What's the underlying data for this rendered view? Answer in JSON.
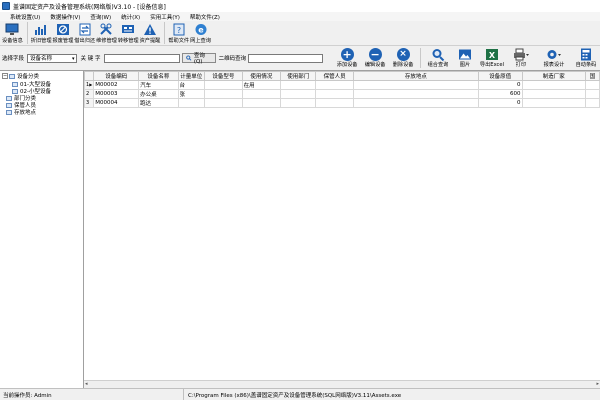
{
  "window": {
    "title": "盖谱固定资产及设备管理系统(网络版)V3.10 - [设备信息]"
  },
  "menu": [
    "系统设置(U)",
    "数据操作(V)",
    "查询(W)",
    "统计(X)",
    "实用工具(Y)",
    "帮助文件(Z)"
  ],
  "toolbar1": [
    {
      "label": "设备信息",
      "icon": "monitor-icon"
    },
    {
      "label": "折旧管理",
      "icon": "bar-chart-icon"
    },
    {
      "label": "报废管理",
      "icon": "scrap-icon"
    },
    {
      "label": "借出归还",
      "icon": "exchange-icon"
    },
    {
      "label": "维修管理",
      "icon": "tools-icon"
    },
    {
      "label": "转移管理",
      "icon": "transfer-icon"
    },
    {
      "label": "资产提醒",
      "icon": "warning-icon"
    },
    {
      "label": "帮助文件",
      "icon": "help-book-icon"
    },
    {
      "label": "网上查询",
      "icon": "browser-icon"
    }
  ],
  "search": {
    "field_label": "选择字段",
    "field_value": "设备名称",
    "keyword_label": "关 键 字",
    "keyword_value": "",
    "query_button": "查询(Q)",
    "qr_label": "二维码查询",
    "qr_value": ""
  },
  "toolbar2": [
    {
      "label": "添加设备",
      "icon": "add-icon"
    },
    {
      "label": "编辑设备",
      "icon": "edit-icon"
    },
    {
      "label": "删除设备",
      "icon": "delete-icon"
    },
    {
      "label": "组合查询",
      "icon": "search-icon"
    },
    {
      "label": "图片",
      "icon": "picture-icon"
    },
    {
      "label": "导出Excel",
      "icon": "excel-icon"
    },
    {
      "label": "打印",
      "icon": "printer-icon"
    },
    {
      "label": "报表设计",
      "icon": "gear-icon"
    },
    {
      "label": "自动条码",
      "icon": "calculator-icon"
    }
  ],
  "tree": {
    "root": "设备分类",
    "children": [
      "01-大型设备",
      "02-小型设备"
    ],
    "others": [
      "部门分类",
      "保管人员",
      "存放地点"
    ]
  },
  "table": {
    "columns": [
      "设备编码",
      "设备名称",
      "计量单位",
      "设备型号",
      "使用情况",
      "使用部门",
      "保管人员",
      "存放地点",
      "设备原值",
      "制造厂家",
      "国"
    ],
    "rows": [
      {
        "index": "1",
        "cells": [
          "M00002",
          "汽车",
          "台",
          "",
          "在用",
          "",
          "",
          "",
          "0",
          "",
          ""
        ]
      },
      {
        "index": "2",
        "cells": [
          "M00003",
          "办公桌",
          "张",
          "",
          "",
          "",
          "",
          "",
          "600",
          "",
          ""
        ]
      },
      {
        "index": "3",
        "cells": [
          "M00004",
          "跑达",
          "",
          "",
          "",
          "",
          "",
          "",
          "0",
          "",
          ""
        ]
      }
    ],
    "current_row_marker": "▶"
  },
  "status": {
    "operator": "当前操作员: Admin",
    "path": "C:\\Program Files (x86)\\盖谱固定资产及设备管理系统(SQL网络版)V3.11\\Assets.exe"
  },
  "colors": {
    "accent_blue": "#1f62b4",
    "excel_green": "#1e7145",
    "warning_yellow": "#f2b705"
  }
}
